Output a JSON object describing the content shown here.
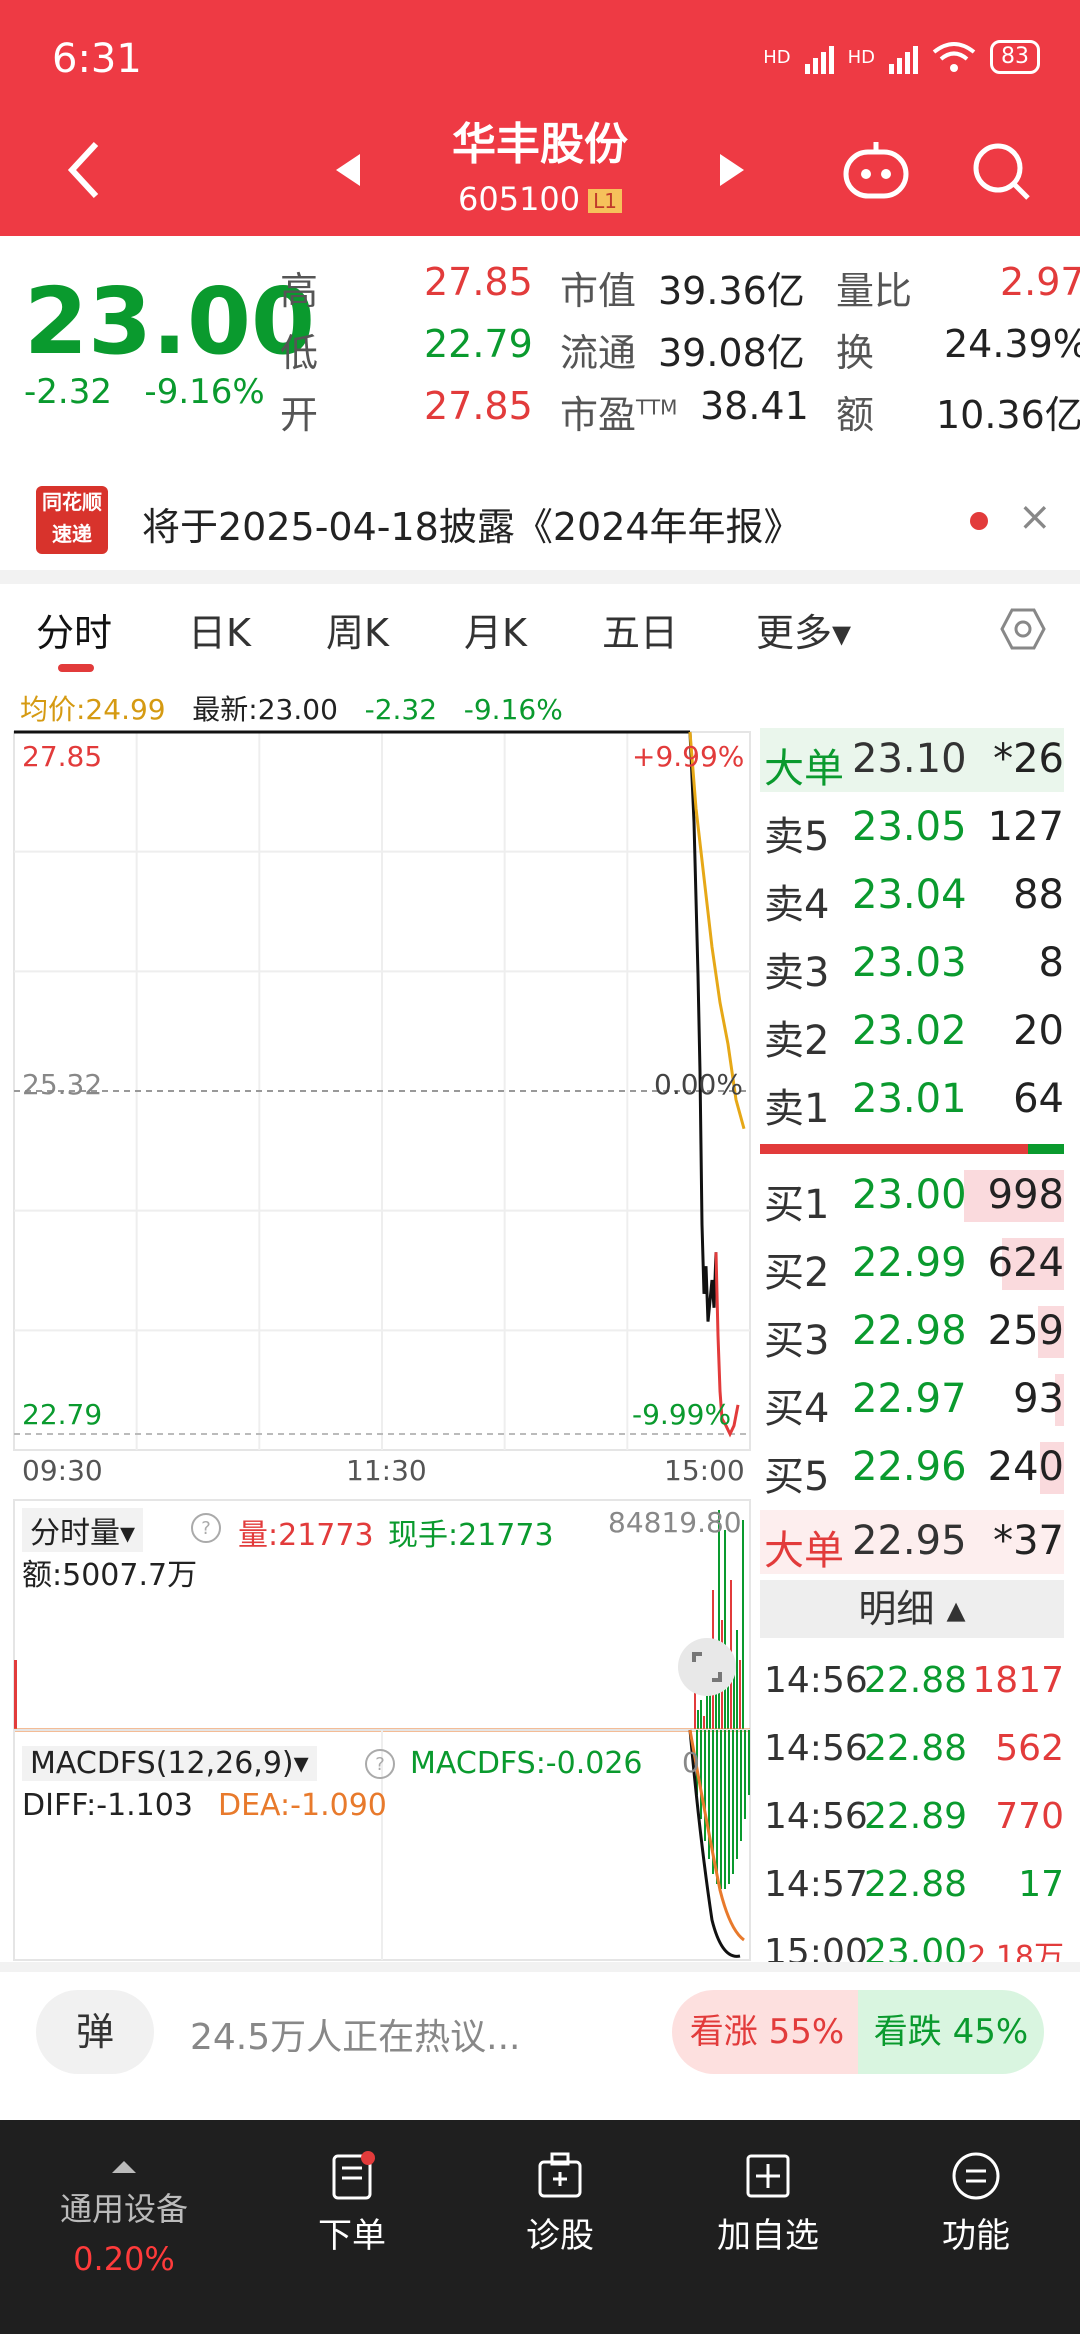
{
  "status": {
    "time": "6:31",
    "hd1": "HD",
    "hd2": "HD",
    "battery": "83"
  },
  "header": {
    "name": "华丰股份",
    "code": "605100",
    "level": "L1"
  },
  "quote": {
    "price": "23.00",
    "change": "-2.32",
    "change_pct": "-9.16%",
    "high_label": "高",
    "high": "27.85",
    "low_label": "低",
    "low": "22.79",
    "open_label": "开",
    "open": "27.85",
    "mktcap_label": "市值",
    "mktcap": "39.36亿",
    "float_label": "流通",
    "float": "39.08亿",
    "pe_label": "市盈",
    "pe_sup": "TTM",
    "pe": "38.41",
    "volratio_label": "量比",
    "volratio": "2.97",
    "turnover_label": "换",
    "turnover": "24.39%",
    "amount_label": "额",
    "amount": "10.36亿"
  },
  "notice": {
    "logo_top": "同花顺",
    "logo_bottom": "速递",
    "text": "将于2025-04-18披露《2024年年报》",
    "close": "×"
  },
  "tabs": [
    "分时",
    "日K",
    "周K",
    "月K",
    "五日",
    "更多▾"
  ],
  "legend": {
    "avg_label": "均价:24.99",
    "last_label": "最新:23.00",
    "chg": "-2.32",
    "pct": "-9.16%"
  },
  "axis": {
    "y_top": "27.85",
    "y_mid": "25.32",
    "y_bot": "22.79",
    "pct_top": "+9.99%",
    "pct_mid": "0.00%",
    "pct_bot": "-9.99%",
    "t0": "09:30",
    "t1": "11:30",
    "t2": "15:00"
  },
  "volume_panel": {
    "selector": "分时量▾",
    "vol": "量:21773",
    "hand": "现手:21773",
    "max": "84819.80",
    "amount": "额:5007.7万"
  },
  "macd_panel": {
    "selector": "MACDFS(12,26,9)▾",
    "macd": "MACDFS:-0.026",
    "diff": "DIFF:-1.103",
    "dea": "DEA:-1.090",
    "zero": "0"
  },
  "orderbook": {
    "big_sell": {
      "label": "大单",
      "price": "23.10",
      "vol": "*26"
    },
    "asks": [
      {
        "label": "卖5",
        "price": "23.05",
        "vol": "127"
      },
      {
        "label": "卖4",
        "price": "23.04",
        "vol": "88"
      },
      {
        "label": "卖3",
        "price": "23.03",
        "vol": "8"
      },
      {
        "label": "卖2",
        "price": "23.02",
        "vol": "20"
      },
      {
        "label": "卖1",
        "price": "23.01",
        "vol": "64"
      }
    ],
    "bids": [
      {
        "label": "买1",
        "price": "23.00",
        "vol": "998",
        "fill": 1.0
      },
      {
        "label": "买2",
        "price": "22.99",
        "vol": "624",
        "fill": 0.62
      },
      {
        "label": "买3",
        "price": "22.98",
        "vol": "259",
        "fill": 0.26
      },
      {
        "label": "买4",
        "price": "22.97",
        "vol": "93",
        "fill": 0.09
      },
      {
        "label": "买5",
        "price": "22.96",
        "vol": "240",
        "fill": 0.24
      }
    ],
    "big_buy": {
      "label": "大单",
      "price": "22.95",
      "vol": "*37"
    },
    "detail_label": "明细 ▴",
    "ticks": [
      {
        "time": "14:56",
        "price": "22.88",
        "vol": "1817"
      },
      {
        "time": "14:56",
        "price": "22.88",
        "vol": "562"
      },
      {
        "time": "14:56",
        "price": "22.89",
        "vol": "770"
      },
      {
        "time": "14:57",
        "price": "22.88",
        "vol": "17"
      },
      {
        "time": "15:00",
        "price": "23.00",
        "vol": "2.18万"
      }
    ]
  },
  "comments": {
    "danmu": "弹",
    "text": "24.5万人正在热议...",
    "up": "看涨 55%",
    "down": "看跌 45%"
  },
  "nav": {
    "device": "通用设备",
    "device_pct": "0.20%",
    "items": [
      "下单",
      "诊股",
      "加自选",
      "功能"
    ]
  },
  "colors": {
    "up": "#e23b3b",
    "down": "#0a9a2e",
    "header": "#ee3a44",
    "avg": "#e6a817"
  }
}
